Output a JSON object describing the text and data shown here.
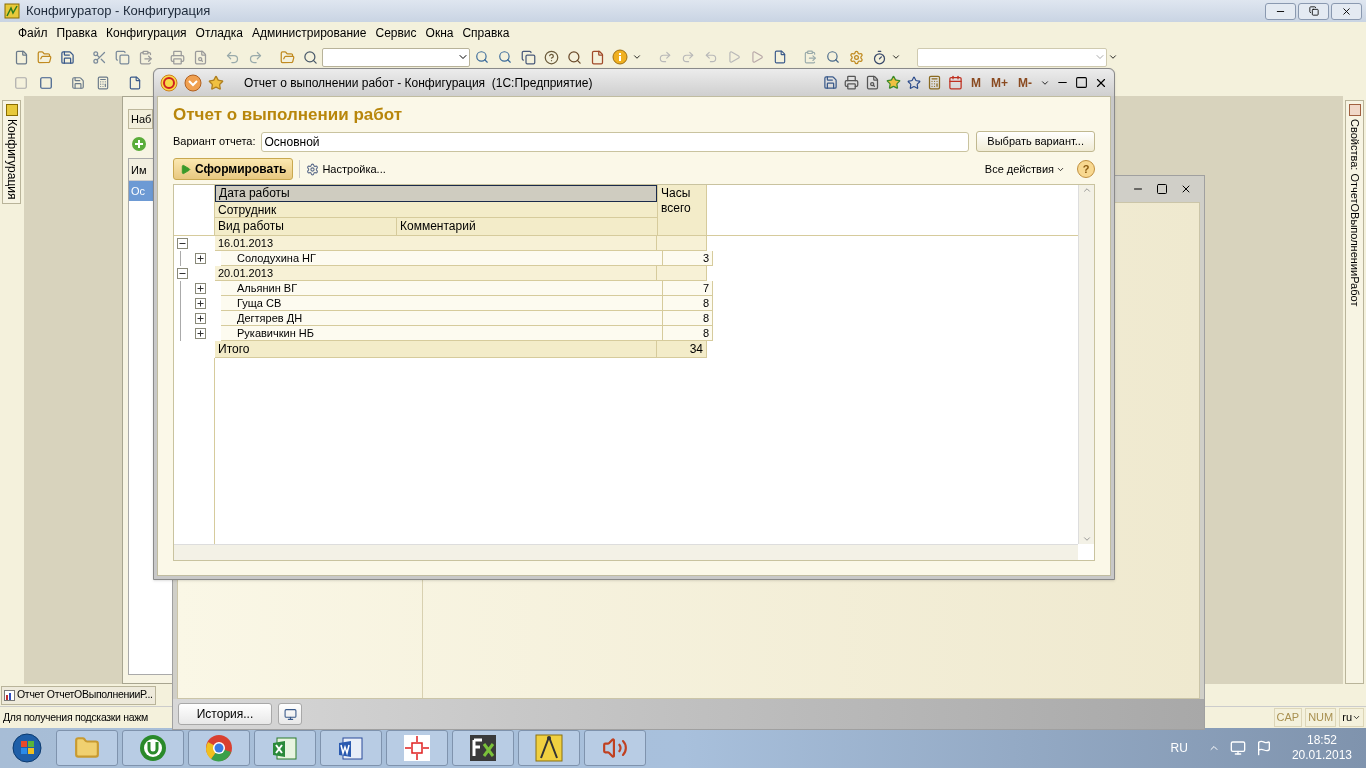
{
  "app_window": {
    "title": "Конфигуратор - Конфигурация"
  },
  "menu": [
    "Файл",
    "Правка",
    "Конфигурация",
    "Отладка",
    "Администрирование",
    "Сервис",
    "Окна",
    "Справка"
  ],
  "left_panel_tab": "Конфигурация",
  "config_window": {
    "tab": "Наб",
    "column": "Им",
    "row": {
      "text": "Ос",
      "selected": true
    }
  },
  "right_panel_tab": "Свойства: ОтчетОВыполненииРабот",
  "report_window": {
    "title": "Отчет о выполнении работ - Конфигурация  (1С:Предприятие)",
    "memory_buttons": [
      "M",
      "M+",
      "M-"
    ],
    "heading": "Отчет о выполнении работ",
    "variant_label": "Вариант отчета:",
    "variant_value": "Основной",
    "choose_variant_button": "Выбрать вариант...",
    "generate_button": "Сформировать",
    "settings_button": "Настройка...",
    "all_actions_button": "Все действия",
    "help_button": "?",
    "report": {
      "header": {
        "date_column": {
          "text": "Дата работы",
          "selected": true
        },
        "employee_column": "Сотрудник",
        "work_type_column": "Вид работы",
        "comment_column": "Комментарий",
        "hours_column": "Часы всего"
      },
      "groups": [
        {
          "date": "16.01.2013",
          "expanded": true,
          "rows": [
            {
              "name": "Солодухина НГ",
              "hours": "3",
              "expanded": false
            }
          ]
        },
        {
          "date": "20.01.2013",
          "expanded": true,
          "rows": [
            {
              "name": "Альянин ВГ",
              "hours": "7",
              "expanded": false
            },
            {
              "name": "Гуща СВ",
              "hours": "8",
              "expanded": false
            },
            {
              "name": "Дегтярев ДН",
              "hours": "8",
              "expanded": false
            },
            {
              "name": "Рукавичкин НБ",
              "hours": "8",
              "expanded": false
            }
          ]
        }
      ],
      "total": {
        "label": "Итого",
        "hours": "34"
      }
    }
  },
  "background_window": {
    "history_button": "История..."
  },
  "bottom_tab": "Отчет ОтчетОВыполненииР...",
  "status_bar": {
    "hint": "Для получения подсказки нажм",
    "indicators": [
      "CAP",
      "NUM"
    ],
    "language": "ru"
  },
  "taskbar": {
    "language": "RU",
    "time": "18:52",
    "date": "20.01.2013"
  }
}
